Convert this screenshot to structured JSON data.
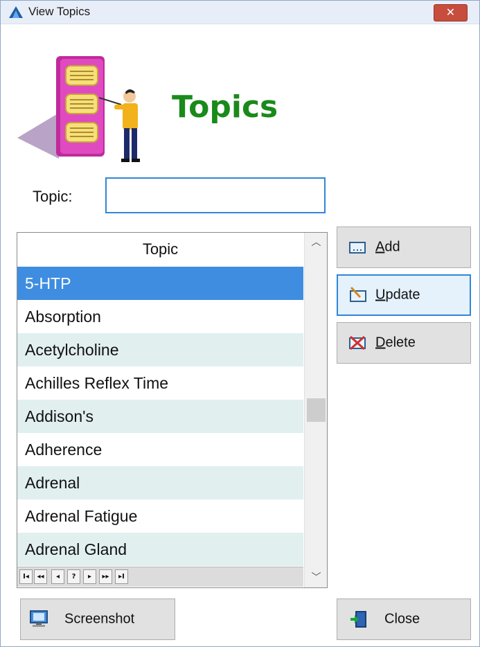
{
  "window": {
    "title": "View Topics",
    "close_symbol": "✕"
  },
  "header": {
    "title": "Topics",
    "icon": "topics-presentation-icon"
  },
  "search": {
    "label": "Topic:",
    "value": "",
    "placeholder": ""
  },
  "list": {
    "column_header": "Topic",
    "rows": [
      "5-HTP",
      "Absorption",
      "Acetylcholine",
      "Achilles Reflex Time",
      "Addison's",
      "Adherence",
      "Adrenal",
      "Adrenal Fatigue",
      "Adrenal Gland"
    ],
    "selected_index": 0,
    "navigator": [
      "I◂",
      "◂◂",
      "◂",
      "?",
      "▸",
      "▸▸",
      "▸I"
    ]
  },
  "buttons": {
    "add": {
      "first": "A",
      "rest": "dd"
    },
    "update": {
      "first": "U",
      "rest": "pdate"
    },
    "delete": {
      "first": "D",
      "rest": "elete"
    },
    "screenshot": "Screenshot",
    "close": "Close"
  },
  "colors": {
    "accent": "#2f86d6",
    "selected_row": "#3f8de0",
    "alt_row": "#e1efef",
    "title_green": "#1a8a1a",
    "close_red": "#c74d3d"
  }
}
